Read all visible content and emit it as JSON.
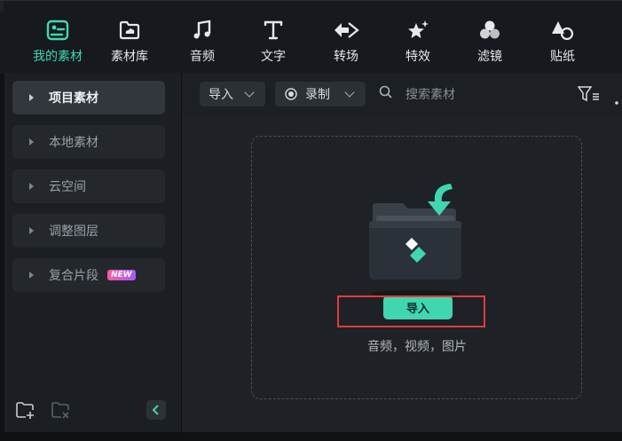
{
  "tabs": [
    {
      "label": "我的素材",
      "icon": "my-media-icon",
      "active": true
    },
    {
      "label": "素材库",
      "icon": "stock-media-icon",
      "active": false
    },
    {
      "label": "音频",
      "icon": "audio-note-icon",
      "active": false
    },
    {
      "label": "文字",
      "icon": "text-t-icon",
      "active": false
    },
    {
      "label": "转场",
      "icon": "transition-icon",
      "active": false
    },
    {
      "label": "特效",
      "icon": "effects-star-icon",
      "active": false
    },
    {
      "label": "滤镜",
      "icon": "filters-icon",
      "active": false
    },
    {
      "label": "贴纸",
      "icon": "stickers-icon",
      "active": false
    }
  ],
  "sidebar": {
    "items": [
      {
        "label": "项目素材",
        "active": true
      },
      {
        "label": "本地素材",
        "active": false
      },
      {
        "label": "云空间",
        "active": false
      },
      {
        "label": "调整图层",
        "active": false
      },
      {
        "label": "复合片段",
        "active": false,
        "badge": "NEW"
      }
    ],
    "new_folder_icon": "add-folder-icon",
    "delete_folder_icon": "delete-folder-icon",
    "collapse_icon": "chevron-left-icon"
  },
  "toolbar": {
    "import_dropdown": "导入",
    "record_dropdown": "录制",
    "search_placeholder": "搜索素材",
    "filter_icon": "filter-icon",
    "more_icon": "more-icon"
  },
  "dropzone": {
    "import_button": "导入",
    "hint": "音频，视频，图片"
  },
  "colors": {
    "accent": "#3fd6b0",
    "highlight_box": "#e33b3b",
    "badge_gradient_start": "#ff5aa0",
    "badge_gradient_end": "#a35cff"
  }
}
